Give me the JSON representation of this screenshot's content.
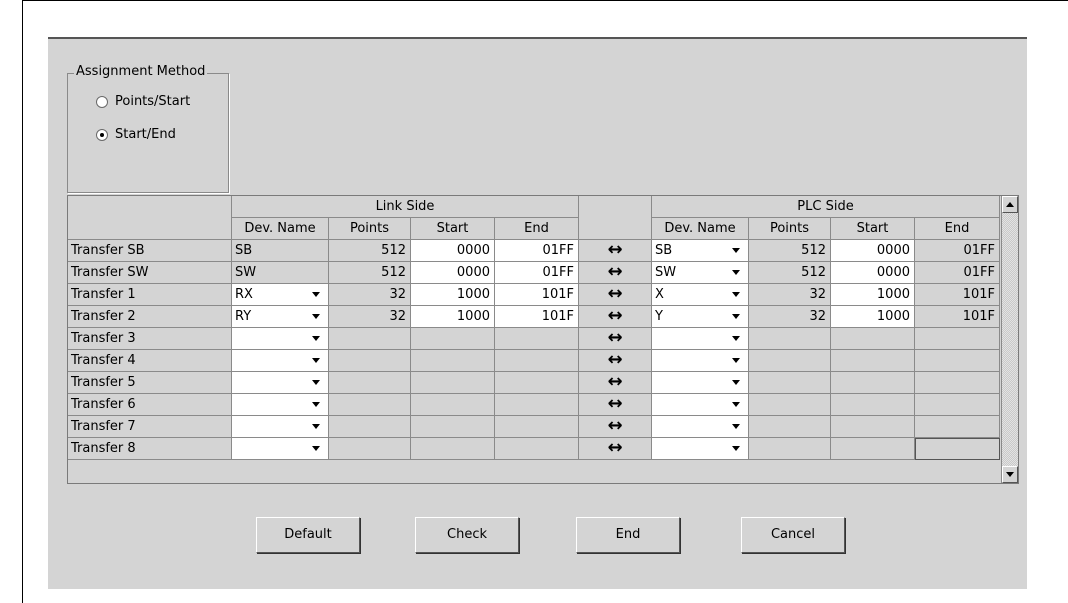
{
  "assignment": {
    "title": "Assignment Method",
    "options": [
      "Points/Start",
      "Start/End"
    ],
    "selected": 1
  },
  "grid": {
    "group_headers": [
      "Link Side",
      "PLC Side"
    ],
    "column_headers": [
      "Dev. Name",
      "Points",
      "Start",
      "End"
    ],
    "rows": [
      {
        "label": "Transfer SB",
        "link": {
          "dev": "SB",
          "points": "512",
          "start": "0000",
          "end": "01FF",
          "dropdown": false
        },
        "plc": {
          "dev": "SB",
          "points": "512",
          "start": "0000",
          "end": "01FF"
        }
      },
      {
        "label": "Transfer SW",
        "link": {
          "dev": "SW",
          "points": "512",
          "start": "0000",
          "end": "01FF",
          "dropdown": false
        },
        "plc": {
          "dev": "SW",
          "points": "512",
          "start": "0000",
          "end": "01FF"
        }
      },
      {
        "label": "Transfer 1",
        "link": {
          "dev": "RX",
          "points": "32",
          "start": "1000",
          "end": "101F",
          "dropdown": true
        },
        "plc": {
          "dev": "X",
          "points": "32",
          "start": "1000",
          "end": "101F"
        }
      },
      {
        "label": "Transfer 2",
        "link": {
          "dev": "RY",
          "points": "32",
          "start": "1000",
          "end": "101F",
          "dropdown": true
        },
        "plc": {
          "dev": "Y",
          "points": "32",
          "start": "1000",
          "end": "101F"
        }
      },
      {
        "label": "Transfer 3",
        "link": {
          "dev": "",
          "points": "",
          "start": "",
          "end": "",
          "dropdown": true
        },
        "plc": {
          "dev": "",
          "points": "",
          "start": "",
          "end": ""
        }
      },
      {
        "label": "Transfer 4",
        "link": {
          "dev": "",
          "points": "",
          "start": "",
          "end": "",
          "dropdown": true
        },
        "plc": {
          "dev": "",
          "points": "",
          "start": "",
          "end": ""
        }
      },
      {
        "label": "Transfer 5",
        "link": {
          "dev": "",
          "points": "",
          "start": "",
          "end": "",
          "dropdown": true
        },
        "plc": {
          "dev": "",
          "points": "",
          "start": "",
          "end": ""
        }
      },
      {
        "label": "Transfer 6",
        "link": {
          "dev": "",
          "points": "",
          "start": "",
          "end": "",
          "dropdown": true
        },
        "plc": {
          "dev": "",
          "points": "",
          "start": "",
          "end": ""
        }
      },
      {
        "label": "Transfer 7",
        "link": {
          "dev": "",
          "points": "",
          "start": "",
          "end": "",
          "dropdown": true
        },
        "plc": {
          "dev": "",
          "points": "",
          "start": "",
          "end": ""
        }
      },
      {
        "label": "Transfer 8",
        "link": {
          "dev": "",
          "points": "",
          "start": "",
          "end": "",
          "dropdown": true
        },
        "plc": {
          "dev": "",
          "points": "",
          "start": "",
          "end": ""
        }
      }
    ],
    "arrow_glyph": "↔"
  },
  "buttons": {
    "default": "Default",
    "check": "Check",
    "end": "End",
    "cancel": "Cancel"
  }
}
